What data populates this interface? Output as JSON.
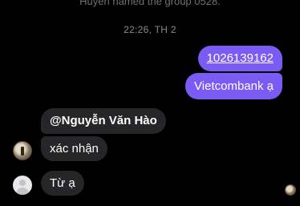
{
  "system_notice": "Huyền named the group 0528.",
  "timestamp": "22:26, TH 2",
  "outgoing": [
    "1026139162",
    "Vietcombank ạ"
  ],
  "incoming": [
    "@Nguyễn Văn Hào",
    "xác nhận",
    "Từ ạ"
  ],
  "colors": {
    "background": "#000000",
    "outgoing_bubble": "#7a5cf4",
    "incoming_bubble": "#262628"
  },
  "icons": {
    "sender_avatar_photo": "avatar-photo",
    "sender_avatar_default": "default-user-avatar",
    "read_receipt": "seen-avatar"
  }
}
